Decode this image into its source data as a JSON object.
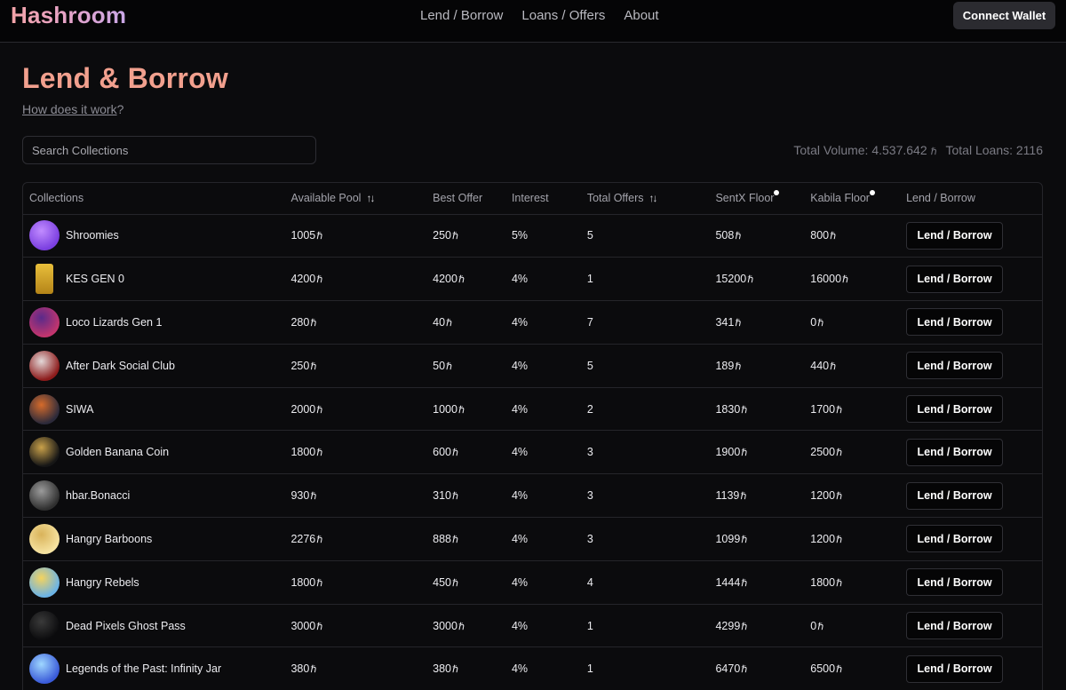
{
  "header": {
    "logo": "Hashroom",
    "nav": [
      "Lend / Borrow",
      "Loans / Offers",
      "About"
    ],
    "connect_label": "Connect Wallet"
  },
  "page": {
    "title": "Lend & Borrow",
    "how_link": "How does it work",
    "how_suffix": "?"
  },
  "search": {
    "placeholder": "Search Collections"
  },
  "totals": {
    "volume_label": "Total Volume: 4.537.642",
    "currency_symbol": "ℏ",
    "loans_label": "Total Loans: 2116"
  },
  "table": {
    "headers": [
      "Collections",
      "Available Pool",
      "Best Offer",
      "Interest",
      "Total Offers",
      "SentX Floor",
      "Kabila Floor",
      "Lend / Borrow"
    ],
    "button_label": "Lend / Borrow",
    "rows": [
      {
        "name": "Shroomies",
        "pool": "1005",
        "best": "250",
        "interest": "5%",
        "offers": "5",
        "sentx": "508",
        "kabila": "800",
        "avatar": "shroomies",
        "colors": [
          "#7b3fe0",
          "#c18cff"
        ]
      },
      {
        "name": "KES GEN 0",
        "pool": "4200",
        "best": "4200",
        "interest": "4%",
        "offers": "1",
        "sentx": "15200",
        "kabila": "16000",
        "avatar": "kes-card",
        "colors": [
          "#0b0b0d",
          "#d9a824"
        ]
      },
      {
        "name": "Loco Lizards Gen 1",
        "pool": "280",
        "best": "40",
        "interest": "4%",
        "offers": "7",
        "sentx": "341",
        "kabila": "0",
        "avatar": "lizard",
        "colors": [
          "#c2356e",
          "#5a2a8a"
        ]
      },
      {
        "name": "After Dark Social Club",
        "pool": "250",
        "best": "50",
        "interest": "4%",
        "offers": "5",
        "sentx": "189",
        "kabila": "440",
        "avatar": "after-dark",
        "colors": [
          "#8c1b1b",
          "#e3d8d8"
        ]
      },
      {
        "name": "SIWA",
        "pool": "2000",
        "best": "1000",
        "interest": "4%",
        "offers": "2",
        "sentx": "1830",
        "kabila": "1700",
        "avatar": "siwa",
        "colors": [
          "#2c2a3a",
          "#d66b2b"
        ]
      },
      {
        "name": "Golden Banana Coin",
        "pool": "1800",
        "best": "600",
        "interest": "4%",
        "offers": "3",
        "sentx": "1900",
        "kabila": "2500",
        "avatar": "banana-coin",
        "colors": [
          "#161616",
          "#c9a14a"
        ]
      },
      {
        "name": "hbar.Bonacci",
        "pool": "930",
        "best": "310",
        "interest": "4%",
        "offers": "3",
        "sentx": "1139",
        "kabila": "1200",
        "avatar": "bonacci",
        "colors": [
          "#2f2f2f",
          "#9b9b9b"
        ]
      },
      {
        "name": "Hangry Barboons",
        "pool": "2276",
        "best": "888",
        "interest": "4%",
        "offers": "3",
        "sentx": "1099",
        "kabila": "1200",
        "avatar": "barboon",
        "colors": [
          "#f6e3a1",
          "#d9b35a"
        ]
      },
      {
        "name": "Hangry Rebels",
        "pool": "1800",
        "best": "450",
        "interest": "4%",
        "offers": "4",
        "sentx": "1444",
        "kabila": "1800",
        "avatar": "rebel",
        "colors": [
          "#6bb3e6",
          "#f4d35e"
        ]
      },
      {
        "name": "Dead Pixels Ghost Pass",
        "pool": "3000",
        "best": "3000",
        "interest": "4%",
        "offers": "1",
        "sentx": "4299",
        "kabila": "0",
        "avatar": "ghost-pass",
        "colors": [
          "#0b0b0d",
          "#3a3a3a"
        ]
      },
      {
        "name": "Legends of the Past: Infinity Jar",
        "pool": "380",
        "best": "380",
        "interest": "4%",
        "offers": "1",
        "sentx": "6470",
        "kabila": "6500",
        "avatar": "infinity-jar",
        "colors": [
          "#3a5bd9",
          "#9fd7ff"
        ]
      }
    ]
  }
}
